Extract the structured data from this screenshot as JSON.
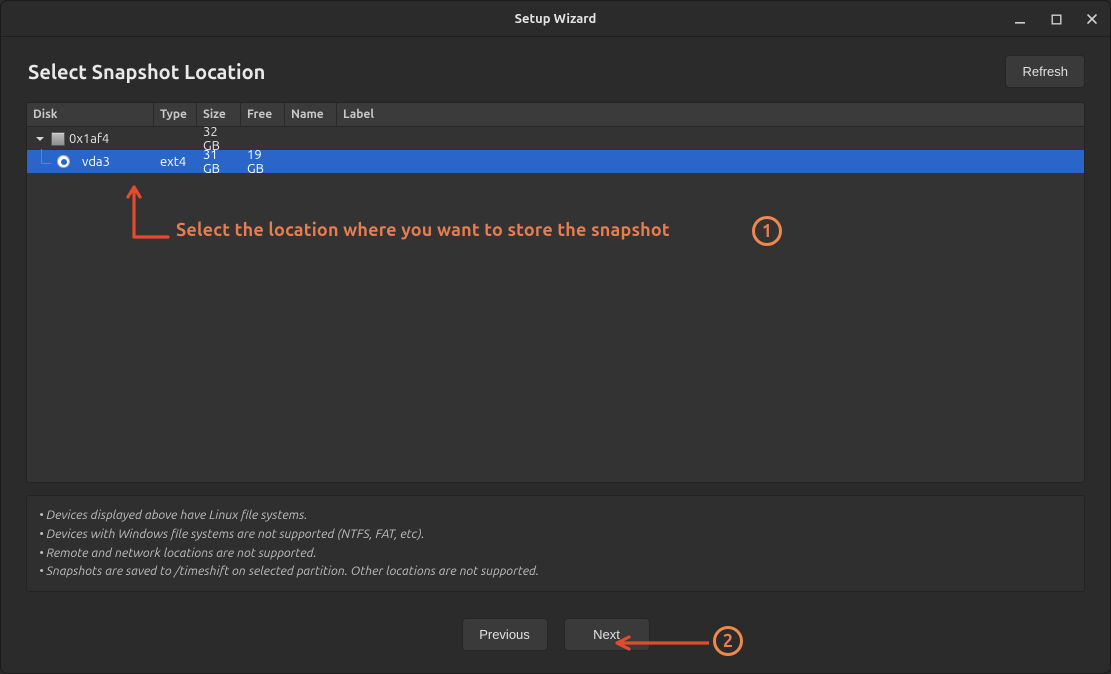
{
  "window": {
    "title": "Setup Wizard"
  },
  "heading": "Select Snapshot Location",
  "buttons": {
    "refresh": "Refresh",
    "previous": "Previous",
    "next": "Next"
  },
  "columns": {
    "disk": "Disk",
    "type": "Type",
    "size": "Size",
    "free": "Free",
    "name": "Name",
    "label": "Label"
  },
  "rows": [
    {
      "kind": "disk",
      "expanded": true,
      "disk": "0x1af4",
      "type": "",
      "size": "32 GB",
      "free": "",
      "name": "",
      "label": "",
      "selected": false
    },
    {
      "kind": "partition",
      "disk": "vda3",
      "type": "ext4",
      "size": "31 GB",
      "free": "19 GB",
      "name": "",
      "label": "",
      "selected": true,
      "radio_checked": true
    }
  ],
  "notes": [
    "• Devices displayed above have Linux file systems.",
    "• Devices with Windows file systems are not supported (NTFS, FAT, etc).",
    "• Remote and network locations are not supported.",
    "• Snapshots are saved to /timeshift on selected partition. Other locations are not supported."
  ],
  "annotations": {
    "step1_text": "Select the location where you want to store the snapshot",
    "step1_num": "1",
    "step2_num": "2"
  },
  "colors": {
    "accent_orange": "#e87d50",
    "selection_blue": "#2a66c9"
  }
}
